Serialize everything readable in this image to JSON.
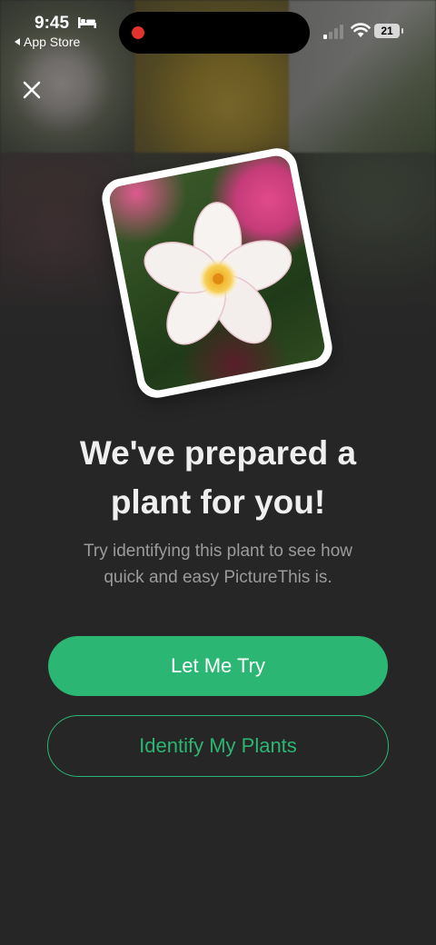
{
  "status_bar": {
    "time": "9:45",
    "back_app": "App Store",
    "battery": "21",
    "icons": [
      "bed-icon",
      "record-dot",
      "signal-icon",
      "wifi-icon",
      "battery-icon"
    ]
  },
  "close_icon": "close-icon",
  "headline_line1": "We've prepared a",
  "headline_line2": "plant for you!",
  "subtext_line1": "Try identifying this plant to see how",
  "subtext_line2": "quick and easy PictureThis is.",
  "primary_button": "Let Me Try",
  "secondary_button": "Identify My Plants",
  "colors": {
    "background": "#262626",
    "accent": "#2bb673",
    "headline": "#efefef",
    "subtext": "#9b9b9b"
  }
}
